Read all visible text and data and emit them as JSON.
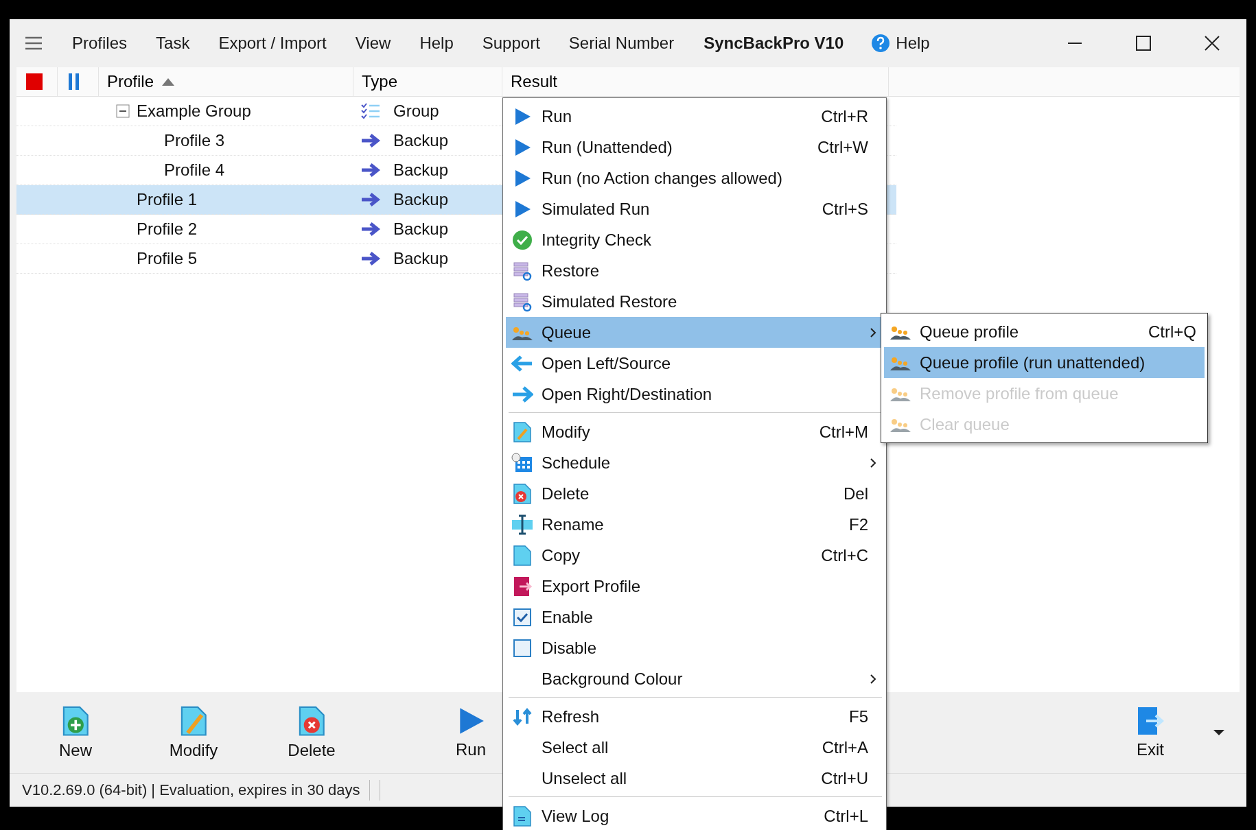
{
  "menubar": {
    "items": [
      "Profiles",
      "Task",
      "Export / Import",
      "View",
      "Help",
      "Support",
      "Serial Number"
    ],
    "title": "SyncBackPro V10",
    "help": "Help"
  },
  "columns": [
    "Profile",
    "Type",
    "Result"
  ],
  "profiles": [
    {
      "name": "Example Group",
      "type": "Group",
      "kind": "group",
      "selected": false,
      "expanded": true,
      "children": [
        {
          "name": "Profile 3",
          "type": "Backup",
          "kind": "backup",
          "selected": false
        },
        {
          "name": "Profile 4",
          "type": "Backup",
          "kind": "backup",
          "selected": false
        }
      ]
    },
    {
      "name": "Profile 1",
      "type": "Backup",
      "kind": "backup",
      "selected": true
    },
    {
      "name": "Profile 2",
      "type": "Backup",
      "kind": "backup",
      "selected": false
    },
    {
      "name": "Profile 5",
      "type": "Backup",
      "kind": "backup",
      "selected": false
    }
  ],
  "toolbar": [
    {
      "label": "New",
      "kind": "new"
    },
    {
      "label": "Modify",
      "kind": "modify"
    },
    {
      "label": "Delete",
      "kind": "delete"
    },
    {
      "label": "Run",
      "kind": "run"
    }
  ],
  "exit_button": "Exit",
  "status_bar": "V10.2.69.0 (64-bit) | Evaluation, expires in 30 days",
  "context_menu": {
    "items": [
      {
        "kind": "item",
        "label": "Run",
        "shortcut": "Ctrl+R",
        "selected": false
      },
      {
        "kind": "item",
        "label": "Run (Unattended)",
        "shortcut": "Ctrl+W",
        "selected": false
      },
      {
        "kind": "item",
        "label": "Run (no Action changes allowed)",
        "selected": false
      },
      {
        "kind": "item",
        "label": "Simulated Run",
        "shortcut": "Ctrl+S",
        "selected": false
      },
      {
        "kind": "item",
        "label": "Integrity Check",
        "selected": false
      },
      {
        "kind": "item",
        "label": "Restore",
        "selected": false
      },
      {
        "kind": "item",
        "label": "Simulated Restore",
        "selected": false
      },
      {
        "kind": "item",
        "label": "Queue",
        "submenu": true,
        "selected": true
      },
      {
        "kind": "item",
        "label": "Open Left/Source",
        "selected": false
      },
      {
        "kind": "item",
        "label": "Open Right/Destination",
        "selected": false
      },
      {
        "kind": "separator"
      },
      {
        "kind": "item",
        "label": "Modify",
        "shortcut": "Ctrl+M",
        "selected": false
      },
      {
        "kind": "item",
        "label": "Schedule",
        "submenu": true,
        "selected": false
      },
      {
        "kind": "item",
        "label": "Delete",
        "shortcut": "Del",
        "selected": false
      },
      {
        "kind": "item",
        "label": "Rename",
        "shortcut": "F2",
        "selected": false
      },
      {
        "kind": "item",
        "label": "Copy",
        "shortcut": "Ctrl+C",
        "selected": false
      },
      {
        "kind": "item",
        "label": "Export Profile",
        "selected": false
      },
      {
        "kind": "item",
        "label": "Enable",
        "selected": false
      },
      {
        "kind": "item",
        "label": "Disable",
        "selected": false
      },
      {
        "kind": "item",
        "label": "Background Colour",
        "submenu": true,
        "selected": false
      },
      {
        "kind": "separator"
      },
      {
        "kind": "item",
        "label": "Refresh",
        "shortcut": "F5",
        "selected": false
      },
      {
        "kind": "item",
        "label": "Select all",
        "shortcut": "Ctrl+A",
        "selected": false
      },
      {
        "kind": "item",
        "label": "Unselect all",
        "shortcut": "Ctrl+U",
        "selected": false
      },
      {
        "kind": "separator"
      },
      {
        "kind": "item",
        "label": "View Log",
        "shortcut": "Ctrl+L",
        "selected": false
      }
    ]
  },
  "submenu": {
    "items": [
      {
        "label": "Queue profile",
        "shortcut": "Ctrl+Q",
        "selected": false,
        "disabled": false
      },
      {
        "label": "Queue profile (run unattended)",
        "selected": true,
        "disabled": false
      },
      {
        "label": "Remove profile from queue",
        "selected": false,
        "disabled": true
      },
      {
        "label": "Clear queue",
        "selected": false,
        "disabled": true
      }
    ]
  }
}
